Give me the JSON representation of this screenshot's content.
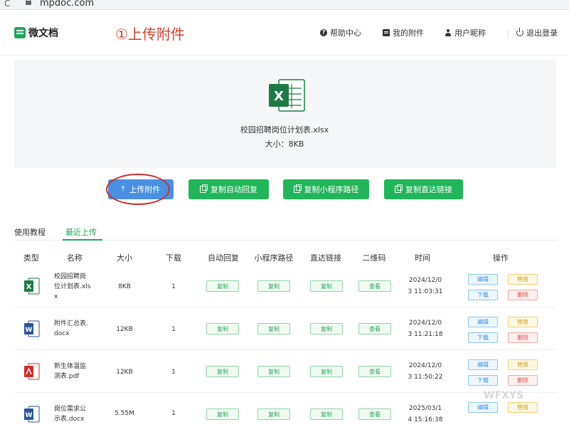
{
  "browser": {
    "url": "mpdoc.com",
    "reload_glyph": "C"
  },
  "header": {
    "logo_text": "微文档",
    "annotation_title": "①上传附件",
    "nav": [
      {
        "label": "帮助中心",
        "icon": "help-icon"
      },
      {
        "label": "我的附件",
        "icon": "file-icon"
      },
      {
        "label": "用户昵称",
        "icon": "user-icon"
      },
      {
        "label": "退出登录",
        "icon": "power-icon"
      }
    ]
  },
  "preview": {
    "file_name": "校园招聘岗位计划表.xlsx",
    "file_size": "大小：8KB"
  },
  "actions": {
    "upload": "上传附件",
    "copy_reply": "复制自动回复",
    "copy_path": "复制小程序路径",
    "copy_link": "复制直达链接"
  },
  "tabs": {
    "tutorial": "使用教程",
    "recent": "最近上传"
  },
  "table": {
    "headers": [
      "类型",
      "名称",
      "大小",
      "下载",
      "自动回复",
      "小程序路径",
      "直达链接",
      "二维码",
      "时间",
      "操作"
    ],
    "copy_label": "复制",
    "view_label": "查看",
    "ops": {
      "edit": "编辑",
      "share": "替换",
      "download": "下载",
      "delete": "删除"
    },
    "rows": [
      {
        "type": "xlsx",
        "name": "校园招聘岗位计划表.xlsx",
        "name_lines": [
          "校园招聘岗",
          "位计划表.xls",
          "x"
        ],
        "size": "8KB",
        "downloads": "1",
        "time_lines": [
          "2024/12/0",
          "3 11:03:31"
        ]
      },
      {
        "type": "docx",
        "name": "附件汇总表.docx",
        "name_lines": [
          "附件汇总表.",
          "docx"
        ],
        "size": "12KB",
        "downloads": "1",
        "time_lines": [
          "2024/12/0",
          "3 11:21:18"
        ]
      },
      {
        "type": "pdf",
        "name": "新生体温监测表.pdf",
        "name_lines": [
          "新生体温监",
          "测表.pdf"
        ],
        "size": "12KB",
        "downloads": "1",
        "time_lines": [
          "2024/12/0",
          "3 11:50:22"
        ]
      },
      {
        "type": "docx",
        "name": "岗位需求公示表.docx",
        "name_lines": [
          "岗位需求公",
          "示表.docx"
        ],
        "size": "5.55M",
        "downloads": "1",
        "time_lines": [
          "2025/03/1",
          "4 15:16:38"
        ]
      }
    ]
  },
  "watermark": "WFXYS",
  "colors": {
    "brand_green": "#22b559",
    "upload_blue": "#4a90e2",
    "annotation_red": "#d23f2b"
  }
}
